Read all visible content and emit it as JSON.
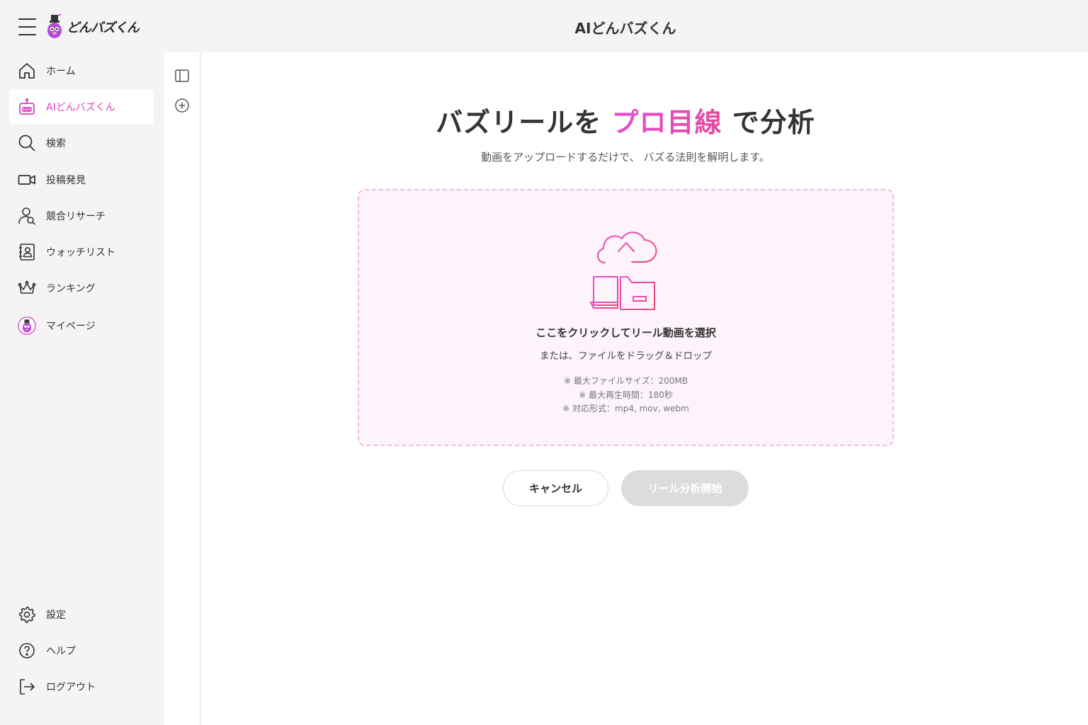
{
  "app": {
    "logo_text": "どんバズくん",
    "page_title": "AIどんバズくん"
  },
  "sidebar": {
    "items": [
      {
        "label": "ホーム",
        "icon": "home-icon"
      },
      {
        "label": "AIどんバズくん",
        "icon": "robot-icon",
        "active": true
      },
      {
        "label": "検索",
        "icon": "search-icon"
      },
      {
        "label": "投稿発見",
        "icon": "video-camera-icon"
      },
      {
        "label": "競合リサーチ",
        "icon": "user-search-icon"
      },
      {
        "label": "ウォッチリスト",
        "icon": "contact-book-icon"
      },
      {
        "label": "ランキング",
        "icon": "crown-icon"
      },
      {
        "label": "マイページ",
        "icon": "avatar-icon"
      }
    ],
    "footer_items": [
      {
        "label": "設定",
        "icon": "gear-icon"
      },
      {
        "label": "ヘルプ",
        "icon": "help-circle-icon"
      },
      {
        "label": "ログアウト",
        "icon": "logout-icon"
      }
    ]
  },
  "main": {
    "headline_before": "バズリールを",
    "headline_highlight": "プロ目線",
    "headline_after": "で分析",
    "subline": "動画をアップロードするだけで、 バズる法則を解明します。",
    "dropzone": {
      "title": "ここをクリックしてリール動画を選択",
      "subtitle": "または、ファイルをドラッグ＆ドロップ",
      "notes": [
        "※ 最大ファイルサイズ：200MB",
        "※ 最大再生時間：180秒",
        "※ 対応形式：mp4, mov, webm"
      ]
    },
    "cancel_label": "キャンセル",
    "start_label": "リール分析開始"
  },
  "colors": {
    "accent": "#d93fc0",
    "accent_gradient_end": "#e64a9a",
    "dropzone_bg": "#fdf3fb",
    "disabled_button": "#dcdcdc"
  }
}
